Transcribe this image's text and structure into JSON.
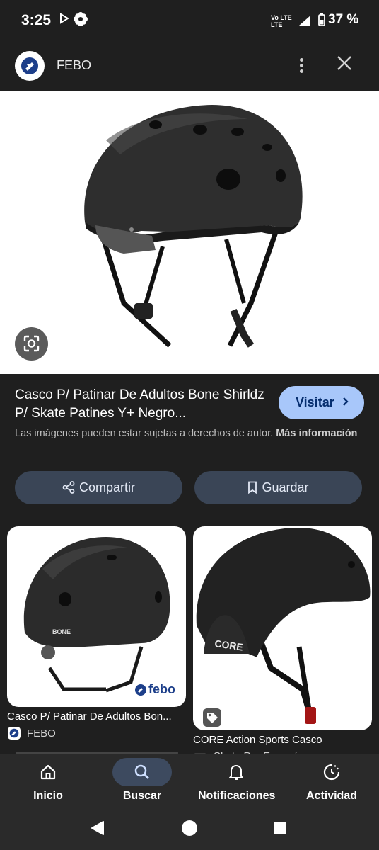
{
  "status_bar": {
    "time": "3:25",
    "network": "Vo LTE",
    "network2": "LTE",
    "battery": "37 %"
  },
  "header": {
    "site_name": "FEBO"
  },
  "result": {
    "title": "Casco P/ Patinar De Adultos Bone Shirldz P/ Skate Patines Y+ Negro...",
    "visit_label": "Visitar",
    "notice": "Las imágenes pueden estar sujetas a derechos de autor.",
    "more_info": "Más información",
    "share_label": "Compartir",
    "save_label": "Guardar"
  },
  "related": [
    {
      "caption": "Casco P/ Patinar De Adultos Bon...",
      "source": "FEBO",
      "watermark": "febo",
      "brand_mark": "BONE"
    },
    {
      "caption": "CORE Action Sports Casco",
      "source": "Skate Pro Espaná",
      "brand_mark": "CORE"
    }
  ],
  "bottom_nav": {
    "items": [
      {
        "label": "Inicio",
        "icon": "home-icon"
      },
      {
        "label": "Buscar",
        "icon": "search-icon",
        "active": true
      },
      {
        "label": "Notificaciones",
        "icon": "bell-icon"
      },
      {
        "label": "Actividad",
        "icon": "activity-icon"
      }
    ]
  },
  "colors": {
    "background": "#1f1f1f",
    "visit_button": "#a8c7fa",
    "pill_button": "#3a4556",
    "brand_blue": "#1d3f8a"
  }
}
